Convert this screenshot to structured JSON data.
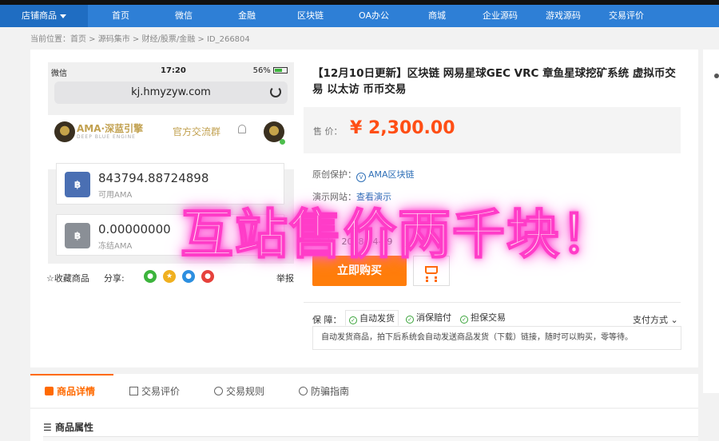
{
  "nav": {
    "items": [
      "店铺商品",
      "首页",
      "微信",
      "金融",
      "区块链",
      "OA办公",
      "商城",
      "企业源码",
      "游戏源码",
      "交易评价"
    ]
  },
  "breadcrumb": "当前位置：首页 > 源码集市 > 财经/股票/金融 > ID_266804",
  "phone": {
    "status_left": "微信",
    "time": "17:20",
    "battery": "56%",
    "url": "kj.hmyzyw.com",
    "brand_name": "AMA·深蓝引擎",
    "brand_sub": "DEEP BLUE ENGINE",
    "group_label": "官方交流群",
    "balance1_value": "843794.88724898",
    "balance1_label": "可用AMA",
    "balance2_value": "0.00000000",
    "balance2_label": "冻结AMA"
  },
  "actions": {
    "favorite": "☆收藏商品",
    "share": "分享:",
    "report": "举报"
  },
  "product": {
    "title": "【12月10日更新】区块链 网易星球GEC VRC 章鱼星球挖矿系统 虚拟币交易 以太访 币币交易",
    "price_label": "售 价：",
    "price": "¥ 2,300.00",
    "copyright_label": "原创保护：",
    "copyright_value": "AMA区块链",
    "demo_label": "演示网站：",
    "demo_value": "查看演示",
    "date_label": "时间：",
    "date_value": "2018-04-09",
    "buy_button": "立即购买"
  },
  "guarantee": {
    "label": "保 障：",
    "items": [
      "自动发货",
      "消保赔付",
      "担保交易"
    ],
    "payment": "支付方式",
    "note": "自动发货商品，拍下后系统会自动发送商品发货（下载）链接，随时可以购买，零等待。"
  },
  "tabs": [
    "商品详情",
    "交易评价",
    "交易规则",
    "防骗指南"
  ],
  "attributes_title": "商品属性",
  "overlay_caption": "互站售价两千块！",
  "colors": {
    "nav_blue": "#2e7fd6",
    "price_orange": "#ff4e15",
    "buy_orange": "#ff7d0a",
    "overlay_pink": "#ff3cc8"
  }
}
